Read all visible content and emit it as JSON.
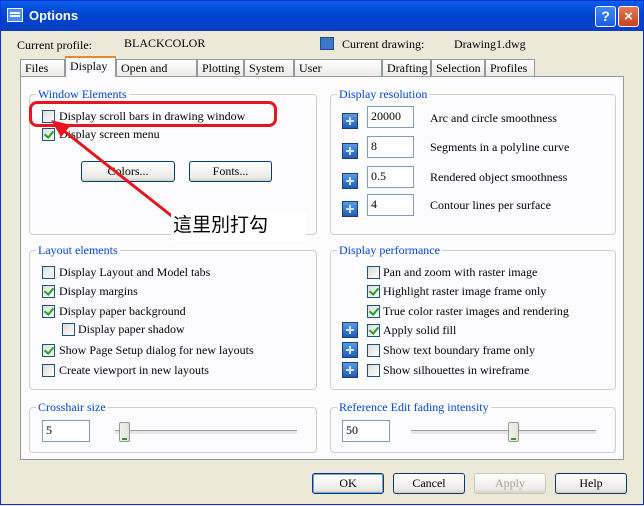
{
  "window": {
    "title": "Options",
    "help_label": "?",
    "close_label": "×"
  },
  "profile": {
    "label": "Current profile:",
    "value": "BLACKCOLOR",
    "drawing_label": "Current drawing:",
    "drawing_value": "Drawing1.dwg"
  },
  "tabs": [
    {
      "label": "Files"
    },
    {
      "label": "Display",
      "active": true
    },
    {
      "label": "Open and Save"
    },
    {
      "label": "Plotting"
    },
    {
      "label": "System"
    },
    {
      "label": "User Preferences"
    },
    {
      "label": "Drafting"
    },
    {
      "label": "Selection"
    },
    {
      "label": "Profiles"
    }
  ],
  "window_elements": {
    "title": "Window Elements",
    "scroll_bars": {
      "label": "Display scroll bars in drawing window",
      "checked": false
    },
    "screen_menu": {
      "label": "Display screen menu",
      "checked": true
    },
    "colors_button": "Colors...",
    "fonts_button": "Fonts..."
  },
  "display_resolution": {
    "title": "Display resolution",
    "items": [
      {
        "value": "20000",
        "label": "Arc and circle smoothness"
      },
      {
        "value": "8",
        "label": "Segments in a polyline curve"
      },
      {
        "value": "0.5",
        "label": "Rendered object smoothness"
      },
      {
        "value": "4",
        "label": "Contour lines per surface"
      }
    ]
  },
  "layout_elements": {
    "title": "Layout elements",
    "items": [
      {
        "label": "Display Layout and Model tabs",
        "checked": false
      },
      {
        "label": "Display margins",
        "checked": true
      },
      {
        "label": "Display paper background",
        "checked": true
      },
      {
        "label": "Display paper shadow",
        "checked": false
      },
      {
        "label": "Show Page Setup dialog for new layouts",
        "checked": true
      },
      {
        "label": "Create viewport in new layouts",
        "checked": false
      }
    ]
  },
  "display_performance": {
    "title": "Display performance",
    "items": [
      {
        "label": "Pan and zoom with raster image",
        "checked": false
      },
      {
        "label": "Highlight raster image frame only",
        "checked": true
      },
      {
        "label": "True color raster images and rendering",
        "checked": true
      },
      {
        "label": "Apply solid fill",
        "checked": true
      },
      {
        "label": "Show text boundary frame only",
        "checked": false
      },
      {
        "label": "Show silhouettes in wireframe",
        "checked": false
      }
    ]
  },
  "crosshair": {
    "title": "Crosshair size",
    "value": "5",
    "slider_fraction": 0.05
  },
  "xref_fade": {
    "title": "Reference Edit fading intensity",
    "value": "50",
    "slider_fraction": 0.55
  },
  "buttons": {
    "ok": "OK",
    "cancel": "Cancel",
    "apply": "Apply",
    "help": "Help"
  },
  "annotation": {
    "text": "這里別打勾"
  },
  "colors": {
    "title_bar": "#0a4ad6",
    "group_title": "#0046d5",
    "annotation": "#e8141e",
    "check": "#21a121"
  }
}
